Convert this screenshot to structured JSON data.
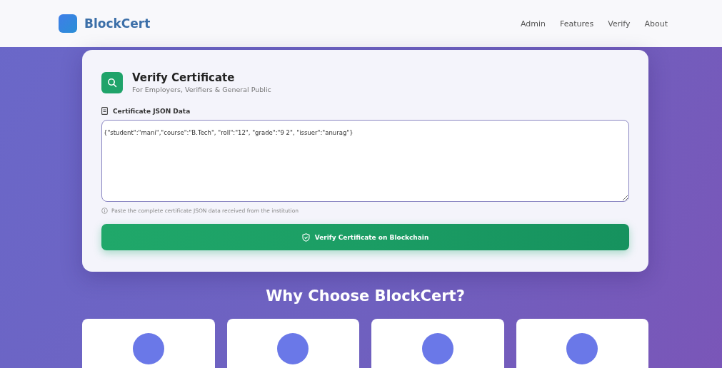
{
  "header": {
    "brand": "BlockCert",
    "nav": [
      "Admin",
      "Features",
      "Verify",
      "About"
    ]
  },
  "verify": {
    "title": "Verify Certificate",
    "subtitle": "For Employers, Verifiers & General Public",
    "field_label": "Certificate JSON Data",
    "value": "{\"student\":\"mani\",\"course\":\"B.Tech\", \"roll\":\"12\", \"grade\":\"9 2\", \"issuer\":\"anurag\"}",
    "hint": "Paste the complete certificate JSON data received from the institution",
    "button": "Verify Certificate on Blockchain"
  },
  "why": {
    "title": "Why Choose BlockCert?"
  }
}
